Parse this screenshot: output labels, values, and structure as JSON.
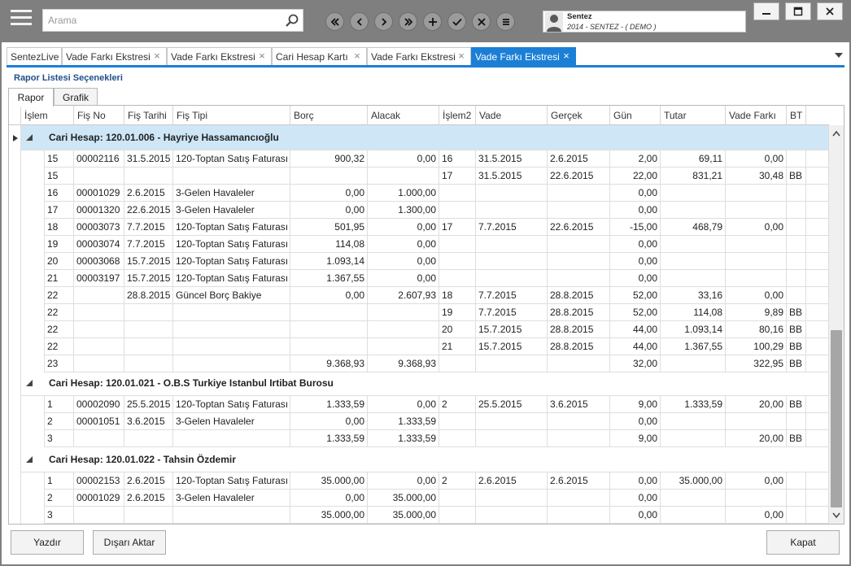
{
  "search": {
    "placeholder": "Arama"
  },
  "user": {
    "name": "Sentez",
    "info": "2014 - SENTEZ - ( DEMO )"
  },
  "navigation_icons": [
    "first-icon",
    "previous-icon",
    "next-icon",
    "last-icon",
    "add-icon",
    "check-icon",
    "delete-icon",
    "menu-icon"
  ],
  "tabs": [
    {
      "label": "SentezLive"
    },
    {
      "label": "Vade Farkı Ekstresi"
    },
    {
      "label": "Vade Farkı Ekstresi"
    },
    {
      "label": "Cari Hesap Kartı"
    },
    {
      "label": "Vade Farkı Ekstresi"
    },
    {
      "label": "Vade Farkı Ekstresi"
    }
  ],
  "section_title": "Rapor Listesi Seçenekleri",
  "subtabs": [
    {
      "label": "Rapor"
    },
    {
      "label": "Grafik"
    }
  ],
  "columns": [
    "İşlem",
    "Fiş No",
    "Fiş Tarihi",
    "Fiş Tipi",
    "Borç",
    "Alacak",
    "İşlem2",
    "Vade",
    "Gerçek",
    "Gün",
    "Tutar",
    "Vade Farkı",
    "BT"
  ],
  "groups": [
    {
      "title": "Cari Hesap: 120.01.006 - Hayriye Hassamancıoğlu",
      "rows": [
        [
          "15",
          "00002116",
          "31.5.2015",
          "120-Toptan Satış Faturası",
          "900,32",
          "0,00",
          "16",
          "31.5.2015",
          "2.6.2015",
          "2,00",
          "69,11",
          "0,00",
          ""
        ],
        [
          "15",
          "",
          "",
          "",
          "",
          "",
          "17",
          "31.5.2015",
          "22.6.2015",
          "22,00",
          "831,21",
          "30,48",
          "BB"
        ],
        [
          "16",
          "00001029",
          "2.6.2015",
          "3-Gelen Havaleler",
          "0,00",
          "1.000,00",
          "",
          "",
          "",
          "0,00",
          "",
          "",
          ""
        ],
        [
          "17",
          "00001320",
          "22.6.2015",
          "3-Gelen Havaleler",
          "0,00",
          "1.300,00",
          "",
          "",
          "",
          "0,00",
          "",
          "",
          ""
        ],
        [
          "18",
          "00003073",
          "7.7.2015",
          "120-Toptan Satış Faturası",
          "501,95",
          "0,00",
          "17",
          "7.7.2015",
          "22.6.2015",
          "-15,00",
          "468,79",
          "0,00",
          ""
        ],
        [
          "19",
          "00003074",
          "7.7.2015",
          "120-Toptan Satış Faturası",
          "114,08",
          "0,00",
          "",
          "",
          "",
          "0,00",
          "",
          "",
          ""
        ],
        [
          "20",
          "00003068",
          "15.7.2015",
          "120-Toptan Satış Faturası",
          "1.093,14",
          "0,00",
          "",
          "",
          "",
          "0,00",
          "",
          "",
          ""
        ],
        [
          "21",
          "00003197",
          "15.7.2015",
          "120-Toptan Satış Faturası",
          "1.367,55",
          "0,00",
          "",
          "",
          "",
          "0,00",
          "",
          "",
          ""
        ],
        [
          "22",
          "",
          "28.8.2015",
          "Güncel Borç Bakiye",
          "0,00",
          "2.607,93",
          "18",
          "7.7.2015",
          "28.8.2015",
          "52,00",
          "33,16",
          "0,00",
          ""
        ],
        [
          "22",
          "",
          "",
          "",
          "",
          "",
          "19",
          "7.7.2015",
          "28.8.2015",
          "52,00",
          "114,08",
          "9,89",
          "BB"
        ],
        [
          "22",
          "",
          "",
          "",
          "",
          "",
          "20",
          "15.7.2015",
          "28.8.2015",
          "44,00",
          "1.093,14",
          "80,16",
          "BB"
        ],
        [
          "22",
          "",
          "",
          "",
          "",
          "",
          "21",
          "15.7.2015",
          "28.8.2015",
          "44,00",
          "1.367,55",
          "100,29",
          "BB"
        ],
        [
          "23",
          "",
          "",
          "",
          "9.368,93",
          "9.368,93",
          "",
          "",
          "",
          "32,00",
          "",
          "322,95",
          "BB"
        ]
      ]
    },
    {
      "title": "Cari Hesap: 120.01.021 - O.B.S Turkiye Istanbul Irtibat Burosu",
      "rows": [
        [
          "1",
          "00002090",
          "25.5.2015",
          "120-Toptan Satış Faturası",
          "1.333,59",
          "0,00",
          "2",
          "25.5.2015",
          "3.6.2015",
          "9,00",
          "1.333,59",
          "20,00",
          "BB"
        ],
        [
          "2",
          "00001051",
          "3.6.2015",
          "3-Gelen Havaleler",
          "0,00",
          "1.333,59",
          "",
          "",
          "",
          "0,00",
          "",
          "",
          ""
        ],
        [
          "3",
          "",
          "",
          "",
          "1.333,59",
          "1.333,59",
          "",
          "",
          "",
          "9,00",
          "",
          "20,00",
          "BB"
        ]
      ]
    },
    {
      "title": "Cari Hesap: 120.01.022 - Tahsin Özdemir",
      "rows": [
        [
          "1",
          "00002153",
          "2.6.2015",
          "120-Toptan Satış Faturası",
          "35.000,00",
          "0,00",
          "2",
          "2.6.2015",
          "2.6.2015",
          "0,00",
          "35.000,00",
          "0,00",
          ""
        ],
        [
          "2",
          "00001029",
          "2.6.2015",
          "3-Gelen Havaleler",
          "0,00",
          "35.000,00",
          "",
          "",
          "",
          "0,00",
          "",
          "",
          ""
        ],
        [
          "3",
          "",
          "",
          "",
          "35.000,00",
          "35.000,00",
          "",
          "",
          "",
          "0,00",
          "",
          "0,00",
          ""
        ]
      ]
    }
  ],
  "buttons": {
    "print": "Yazdır",
    "export": "Dışarı Aktar",
    "close": "Kapat"
  }
}
